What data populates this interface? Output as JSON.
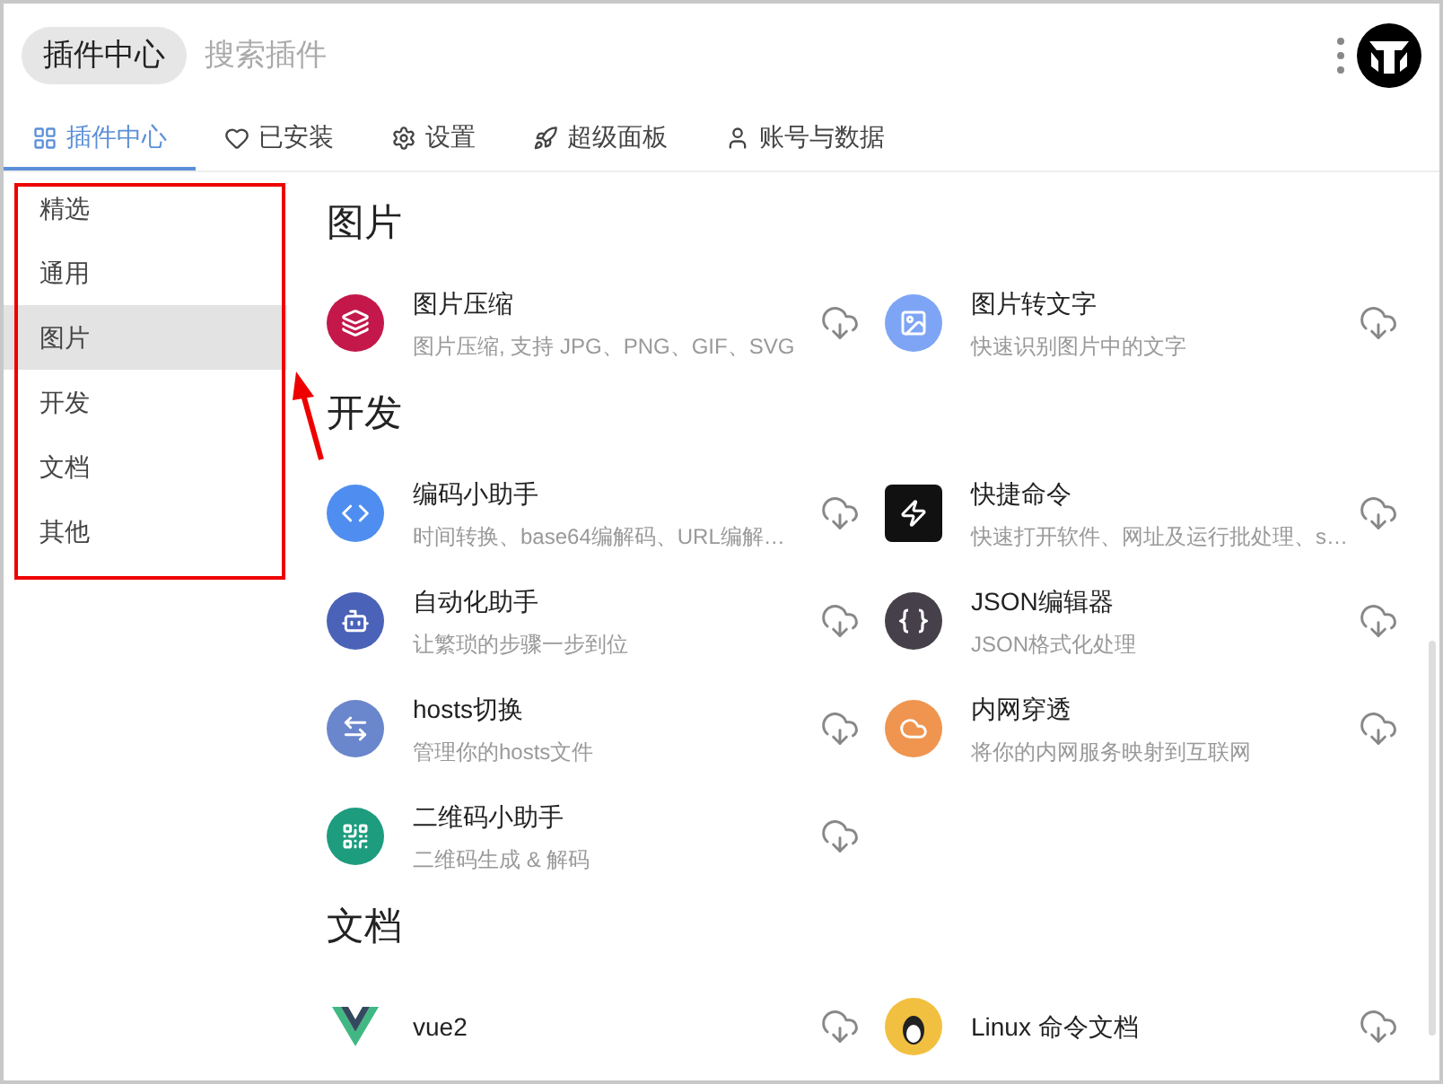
{
  "header": {
    "title": "插件中心",
    "search": {
      "placeholder": "搜索插件"
    }
  },
  "tabs": [
    {
      "label": "插件中心",
      "selected": true
    },
    {
      "label": "已安装",
      "selected": false
    },
    {
      "label": "设置",
      "selected": false
    },
    {
      "label": "超级面板",
      "selected": false
    },
    {
      "label": "账号与数据",
      "selected": false
    }
  ],
  "sidebar": {
    "items": [
      {
        "label": "精选",
        "selected": false
      },
      {
        "label": "通用",
        "selected": false
      },
      {
        "label": "图片",
        "selected": true
      },
      {
        "label": "开发",
        "selected": false
      },
      {
        "label": "文档",
        "selected": false
      },
      {
        "label": "其他",
        "selected": false
      }
    ]
  },
  "sections": [
    {
      "title": "图片",
      "plugins": [
        {
          "name": "图片压缩",
          "description": "图片压缩, 支持 JPG、PNG、GIF、SVG",
          "color": "#c4184a"
        },
        {
          "name": "图片转文字",
          "description": "快速识别图片中的文字",
          "color": "#7ea5f5"
        }
      ]
    },
    {
      "title": "开发",
      "plugins": [
        {
          "name": "编码小助手",
          "description": "时间转换、base64编解码、URL编解…",
          "color": "#4f8ef0"
        },
        {
          "name": "快捷命令",
          "description": "快速打开软件、网址及运行批处理、s…",
          "color": "#111111"
        },
        {
          "name": "自动化助手",
          "description": "让繁琐的步骤一步到位",
          "color": "#4a62b8"
        },
        {
          "name": "JSON编辑器",
          "description": "JSON格式化处理",
          "color": "#45404a"
        },
        {
          "name": "hosts切换",
          "description": "管理你的hosts文件",
          "color": "#6a86cc"
        },
        {
          "name": "内网穿透",
          "description": "将你的内网服务映射到互联网",
          "color": "#ef9550"
        },
        {
          "name": "二维码小助手",
          "description": "二维码生成 & 解码",
          "color": "#1d9c7e"
        }
      ]
    },
    {
      "title": "文档",
      "plugins": [
        {
          "name": "vue2",
          "color": "#41b883"
        },
        {
          "name": "Linux 命令文档",
          "color": "#f2c040"
        }
      ]
    }
  ]
}
